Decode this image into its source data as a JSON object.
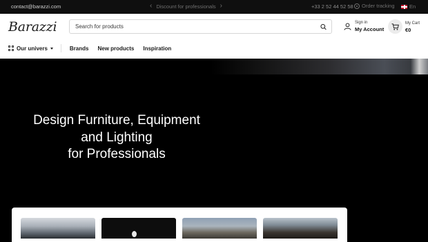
{
  "topbar": {
    "contact": "contact@barazzi.com",
    "promo": "Discount for professionals",
    "phone": "+33 2 52 44 52 58",
    "tracking": "Order tracking",
    "language": "En"
  },
  "header": {
    "logo": "Barazzi",
    "search_placeholder": "Search for products",
    "account": {
      "small": "Sign in",
      "big": "My Account"
    },
    "cart": {
      "small": "My Cart",
      "big": "€0"
    }
  },
  "nav": {
    "univers": "Our univers",
    "links": [
      "Brands",
      "New products",
      "Inspiration"
    ]
  },
  "hero": {
    "title_line1": "Design Furniture, Equipment",
    "title_line2": "and Lighting",
    "title_line3": "for Professionals"
  },
  "colors": {
    "background": "#000000",
    "header": "#ffffff",
    "text_dark": "#1b1b1b"
  }
}
